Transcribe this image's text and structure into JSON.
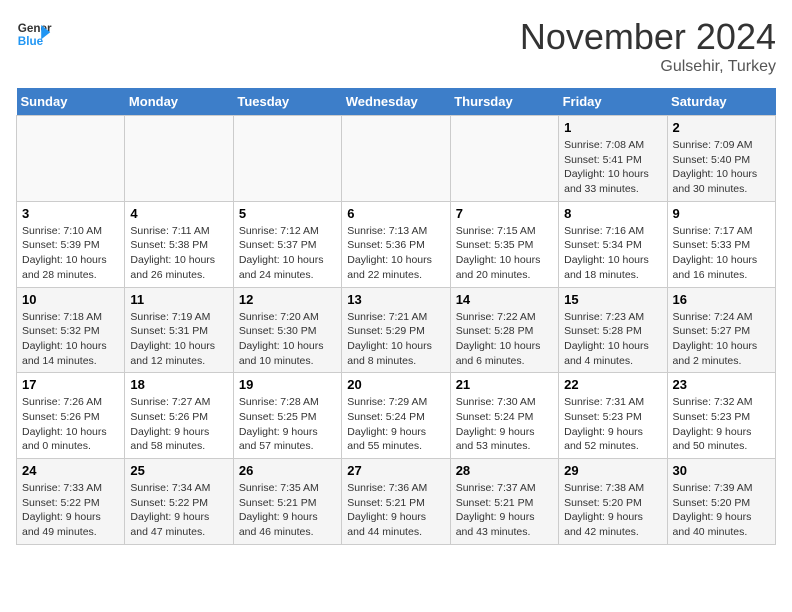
{
  "header": {
    "logo_line1": "General",
    "logo_line2": "Blue",
    "month": "November 2024",
    "location": "Gulsehir, Turkey"
  },
  "days_of_week": [
    "Sunday",
    "Monday",
    "Tuesday",
    "Wednesday",
    "Thursday",
    "Friday",
    "Saturday"
  ],
  "weeks": [
    [
      {
        "num": "",
        "detail": ""
      },
      {
        "num": "",
        "detail": ""
      },
      {
        "num": "",
        "detail": ""
      },
      {
        "num": "",
        "detail": ""
      },
      {
        "num": "",
        "detail": ""
      },
      {
        "num": "1",
        "detail": "Sunrise: 7:08 AM\nSunset: 5:41 PM\nDaylight: 10 hours and 33 minutes."
      },
      {
        "num": "2",
        "detail": "Sunrise: 7:09 AM\nSunset: 5:40 PM\nDaylight: 10 hours and 30 minutes."
      }
    ],
    [
      {
        "num": "3",
        "detail": "Sunrise: 7:10 AM\nSunset: 5:39 PM\nDaylight: 10 hours and 28 minutes."
      },
      {
        "num": "4",
        "detail": "Sunrise: 7:11 AM\nSunset: 5:38 PM\nDaylight: 10 hours and 26 minutes."
      },
      {
        "num": "5",
        "detail": "Sunrise: 7:12 AM\nSunset: 5:37 PM\nDaylight: 10 hours and 24 minutes."
      },
      {
        "num": "6",
        "detail": "Sunrise: 7:13 AM\nSunset: 5:36 PM\nDaylight: 10 hours and 22 minutes."
      },
      {
        "num": "7",
        "detail": "Sunrise: 7:15 AM\nSunset: 5:35 PM\nDaylight: 10 hours and 20 minutes."
      },
      {
        "num": "8",
        "detail": "Sunrise: 7:16 AM\nSunset: 5:34 PM\nDaylight: 10 hours and 18 minutes."
      },
      {
        "num": "9",
        "detail": "Sunrise: 7:17 AM\nSunset: 5:33 PM\nDaylight: 10 hours and 16 minutes."
      }
    ],
    [
      {
        "num": "10",
        "detail": "Sunrise: 7:18 AM\nSunset: 5:32 PM\nDaylight: 10 hours and 14 minutes."
      },
      {
        "num": "11",
        "detail": "Sunrise: 7:19 AM\nSunset: 5:31 PM\nDaylight: 10 hours and 12 minutes."
      },
      {
        "num": "12",
        "detail": "Sunrise: 7:20 AM\nSunset: 5:30 PM\nDaylight: 10 hours and 10 minutes."
      },
      {
        "num": "13",
        "detail": "Sunrise: 7:21 AM\nSunset: 5:29 PM\nDaylight: 10 hours and 8 minutes."
      },
      {
        "num": "14",
        "detail": "Sunrise: 7:22 AM\nSunset: 5:28 PM\nDaylight: 10 hours and 6 minutes."
      },
      {
        "num": "15",
        "detail": "Sunrise: 7:23 AM\nSunset: 5:28 PM\nDaylight: 10 hours and 4 minutes."
      },
      {
        "num": "16",
        "detail": "Sunrise: 7:24 AM\nSunset: 5:27 PM\nDaylight: 10 hours and 2 minutes."
      }
    ],
    [
      {
        "num": "17",
        "detail": "Sunrise: 7:26 AM\nSunset: 5:26 PM\nDaylight: 10 hours and 0 minutes."
      },
      {
        "num": "18",
        "detail": "Sunrise: 7:27 AM\nSunset: 5:26 PM\nDaylight: 9 hours and 58 minutes."
      },
      {
        "num": "19",
        "detail": "Sunrise: 7:28 AM\nSunset: 5:25 PM\nDaylight: 9 hours and 57 minutes."
      },
      {
        "num": "20",
        "detail": "Sunrise: 7:29 AM\nSunset: 5:24 PM\nDaylight: 9 hours and 55 minutes."
      },
      {
        "num": "21",
        "detail": "Sunrise: 7:30 AM\nSunset: 5:24 PM\nDaylight: 9 hours and 53 minutes."
      },
      {
        "num": "22",
        "detail": "Sunrise: 7:31 AM\nSunset: 5:23 PM\nDaylight: 9 hours and 52 minutes."
      },
      {
        "num": "23",
        "detail": "Sunrise: 7:32 AM\nSunset: 5:23 PM\nDaylight: 9 hours and 50 minutes."
      }
    ],
    [
      {
        "num": "24",
        "detail": "Sunrise: 7:33 AM\nSunset: 5:22 PM\nDaylight: 9 hours and 49 minutes."
      },
      {
        "num": "25",
        "detail": "Sunrise: 7:34 AM\nSunset: 5:22 PM\nDaylight: 9 hours and 47 minutes."
      },
      {
        "num": "26",
        "detail": "Sunrise: 7:35 AM\nSunset: 5:21 PM\nDaylight: 9 hours and 46 minutes."
      },
      {
        "num": "27",
        "detail": "Sunrise: 7:36 AM\nSunset: 5:21 PM\nDaylight: 9 hours and 44 minutes."
      },
      {
        "num": "28",
        "detail": "Sunrise: 7:37 AM\nSunset: 5:21 PM\nDaylight: 9 hours and 43 minutes."
      },
      {
        "num": "29",
        "detail": "Sunrise: 7:38 AM\nSunset: 5:20 PM\nDaylight: 9 hours and 42 minutes."
      },
      {
        "num": "30",
        "detail": "Sunrise: 7:39 AM\nSunset: 5:20 PM\nDaylight: 9 hours and 40 minutes."
      }
    ]
  ]
}
